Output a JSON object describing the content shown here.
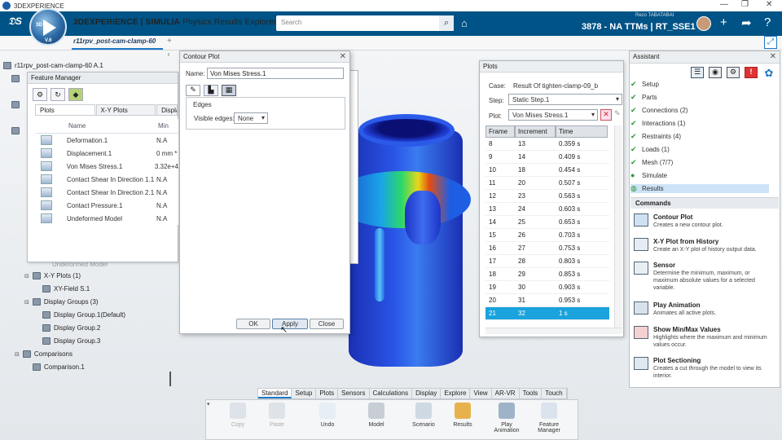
{
  "window": {
    "title": "3DEXPERIENCE"
  },
  "header": {
    "brand_prefix": "3DEXPERIENCE | SIMULIA",
    "brand_app": "Physics Results Explorer",
    "compass_version": "V.6",
    "compass_3d": "3D",
    "search_placeholder": "Search",
    "user_name": "Rezo TABATABAI",
    "workspace": "3878 - NA TTMs | RT_SSE1 ▾"
  },
  "document_tab": {
    "label": "r11rpv_post-cam-clamp-60"
  },
  "tree": {
    "root": "r11rpv_post-cam-clamp-60 A.1",
    "xy_plots": "X-Y Plots (1)",
    "xy_field": "XY-Field S.1",
    "display_groups": "Display Groups (3)",
    "dg1": "Display Group.1(Default)",
    "dg2": "Display Group.2",
    "dg3": "Display Group.3",
    "comparisons": "Comparisons",
    "comparison1": "Comparison.1",
    "hidden_item": "Undeformed Model"
  },
  "feature_manager": {
    "title": "Feature Manager",
    "tabs": [
      "Plots",
      "X-Y Plots",
      "Display"
    ],
    "col_name": "Name",
    "col_min": "Min",
    "rows": [
      {
        "name": "Deformation.1",
        "min": "N.A"
      },
      {
        "name": "Displacement.1",
        "min": "0 mm *"
      },
      {
        "name": "Von Mises Stress.1",
        "min": "3.32e+4"
      },
      {
        "name": "Contact Shear In Direction 1.1",
        "min": "N.A"
      },
      {
        "name": "Contact Shear In Direction 2.1",
        "min": "N.A"
      },
      {
        "name": "Contact Pressure.1",
        "min": "N.A"
      },
      {
        "name": "Undeformed Model",
        "min": "N.A"
      }
    ]
  },
  "contour_plot": {
    "title": "Contour Plot",
    "name_label": "Name:",
    "name_value": "Von Mises Stress.1",
    "edges_group": "Edges",
    "visible_edges_label": "Visible edges:",
    "visible_edges_value": "None",
    "ok": "OK",
    "apply": "Apply",
    "close": "Close"
  },
  "plots_panel": {
    "title": "Plots",
    "case_label": "Case:",
    "case_value": "Result Of tighten-clamp-09_b",
    "step_label": "Step:",
    "step_value": "Static Step.1",
    "plot_label": "Plot:",
    "plot_value": "Von Mises Stress.1",
    "headers": [
      "Frame",
      "Increment",
      "Time"
    ],
    "rows": [
      [
        "8",
        "13",
        "0.359 s"
      ],
      [
        "9",
        "14",
        "0.409 s"
      ],
      [
        "10",
        "18",
        "0.454 s"
      ],
      [
        "11",
        "20",
        "0.507 s"
      ],
      [
        "12",
        "23",
        "0.563 s"
      ],
      [
        "13",
        "24",
        "0.603 s"
      ],
      [
        "14",
        "25",
        "0.653 s"
      ],
      [
        "15",
        "26",
        "0.703 s"
      ],
      [
        "16",
        "27",
        "0.753 s"
      ],
      [
        "17",
        "28",
        "0.803 s"
      ],
      [
        "18",
        "29",
        "0.853 s"
      ],
      [
        "19",
        "30",
        "0.903 s"
      ],
      [
        "20",
        "31",
        "0.953 s"
      ],
      [
        "21",
        "32",
        "1 s"
      ]
    ]
  },
  "assistant": {
    "title": "Assistant",
    "steps": [
      "Setup",
      "Parts",
      "Connections (2)",
      "Interactions (1)",
      "Restraints (4)",
      "Loads (1)",
      "Mesh (7/7)",
      "Simulate",
      "Results"
    ],
    "commands_title": "Commands",
    "commands": [
      {
        "title": "Contour Plot",
        "desc": "Creates a new contour plot."
      },
      {
        "title": "X-Y Plot from History",
        "desc": "Create an X-Y plot of history output data."
      },
      {
        "title": "Sensor",
        "desc": "Determine the minimum, maximum, or maximum absolute values for a selected variable."
      },
      {
        "title": "Play Animation",
        "desc": "Animates all active plots."
      },
      {
        "title": "Show Min/Max Values",
        "desc": "Highlights where the maximum and minimum values occur."
      },
      {
        "title": "Plot Sectioning",
        "desc": "Creates a cut through the model to view its interior."
      }
    ]
  },
  "action_bar": {
    "tabs": [
      "Standard",
      "Setup",
      "Plots",
      "Sensors",
      "Calculations",
      "Display",
      "Explore",
      "View",
      "AR-VR",
      "Tools",
      "Touch"
    ],
    "buttons": [
      "Copy",
      "Paste",
      "Undo",
      "Model",
      "Scenario",
      "Results",
      "Play Animation",
      "Feature Manager"
    ]
  },
  "colors": {
    "header_bg": "#005386",
    "accent": "#1b76c8",
    "selection": "#1aa3dc"
  }
}
